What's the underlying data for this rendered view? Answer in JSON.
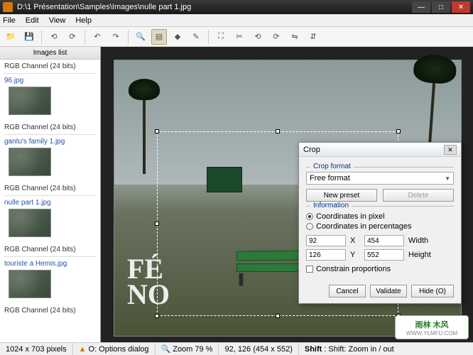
{
  "window": {
    "title": "D:\\1 Présentation\\Samples\\Images\\nulle part 1.jpg"
  },
  "menu": {
    "file": "File",
    "edit": "Edit",
    "view": "View",
    "help": "Help"
  },
  "sidebar": {
    "header": "Images list",
    "items": [
      {
        "channel": "RGB Channel (24 bits)",
        "name": "96.jpg"
      },
      {
        "channel": "RGB Channel (24 bits)",
        "name": "gantu's family 1.jpg"
      },
      {
        "channel": "RGB Channel (24 bits)",
        "name": "nulle part 1.jpg"
      },
      {
        "channel": "RGB Channel (24 bits)",
        "name": "touriste a Hemis.jpg"
      },
      {
        "channel": "RGB Channel (24 bits)",
        "name": ""
      }
    ]
  },
  "crop": {
    "title": "Crop",
    "format_group": "Crop format",
    "format_value": "Free format",
    "new_preset": "New preset",
    "delete": "Delete",
    "info_group": "Information",
    "coord_px": "Coordinates in pixel",
    "coord_pct": "Coordinates in percentages",
    "x": "92",
    "y": "126",
    "w": "454",
    "h": "552",
    "xlabel": "X",
    "ylabel": "Y",
    "wlabel": "Width",
    "hlabel": "Height",
    "constrain": "Constrain proportions",
    "cancel": "Cancel",
    "validate": "Validate",
    "hide": "Hide (O)"
  },
  "status": {
    "dims": "1024 x 703 pixels",
    "opts": "O: Options dialog",
    "zoom": "Zoom 79 %",
    "coords": "92, 126 (454 x 552)",
    "shift": "Shift: Zoom in / out"
  },
  "watermark": {
    "l1": "雨林 木风",
    "l2": "WWW.YLMFU.COM"
  }
}
